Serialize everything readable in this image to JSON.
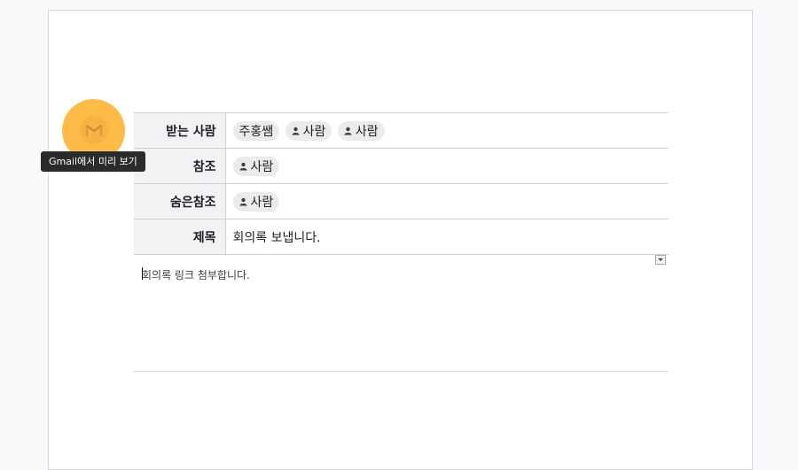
{
  "fields": {
    "to": {
      "label": "받는 사람",
      "recipients": [
        "주홍쌤",
        "사람",
        "사람"
      ]
    },
    "cc": {
      "label": "참조",
      "recipients": [
        "사람"
      ]
    },
    "bcc": {
      "label": "숨은참조",
      "recipients": [
        "사람"
      ]
    },
    "subject": {
      "label": "제목",
      "value": "회의록 보냅니다."
    }
  },
  "body": {
    "text": "회의록 링크 첨부합니다."
  },
  "preview": {
    "tooltip": "Gmail에서 미리 보기",
    "icon": "gmail-icon",
    "accent": "#fdbb47"
  },
  "icons": {
    "person": "person-icon",
    "dropdown": "dropdown-arrow-icon"
  }
}
